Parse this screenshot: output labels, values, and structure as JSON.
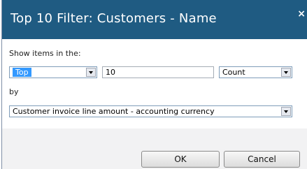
{
  "dialog": {
    "title": "Top 10 Filter: Customers - Name",
    "close_glyph": "×"
  },
  "form": {
    "show_items_label": "Show items in the:",
    "direction": {
      "selected": "Top"
    },
    "count_value": "10",
    "type": {
      "selected": "Count"
    },
    "by_label": "by",
    "field": {
      "selected": "Customer invoice line amount - accounting currency"
    }
  },
  "buttons": {
    "ok_label": "OK",
    "cancel_label": "Cancel"
  }
}
